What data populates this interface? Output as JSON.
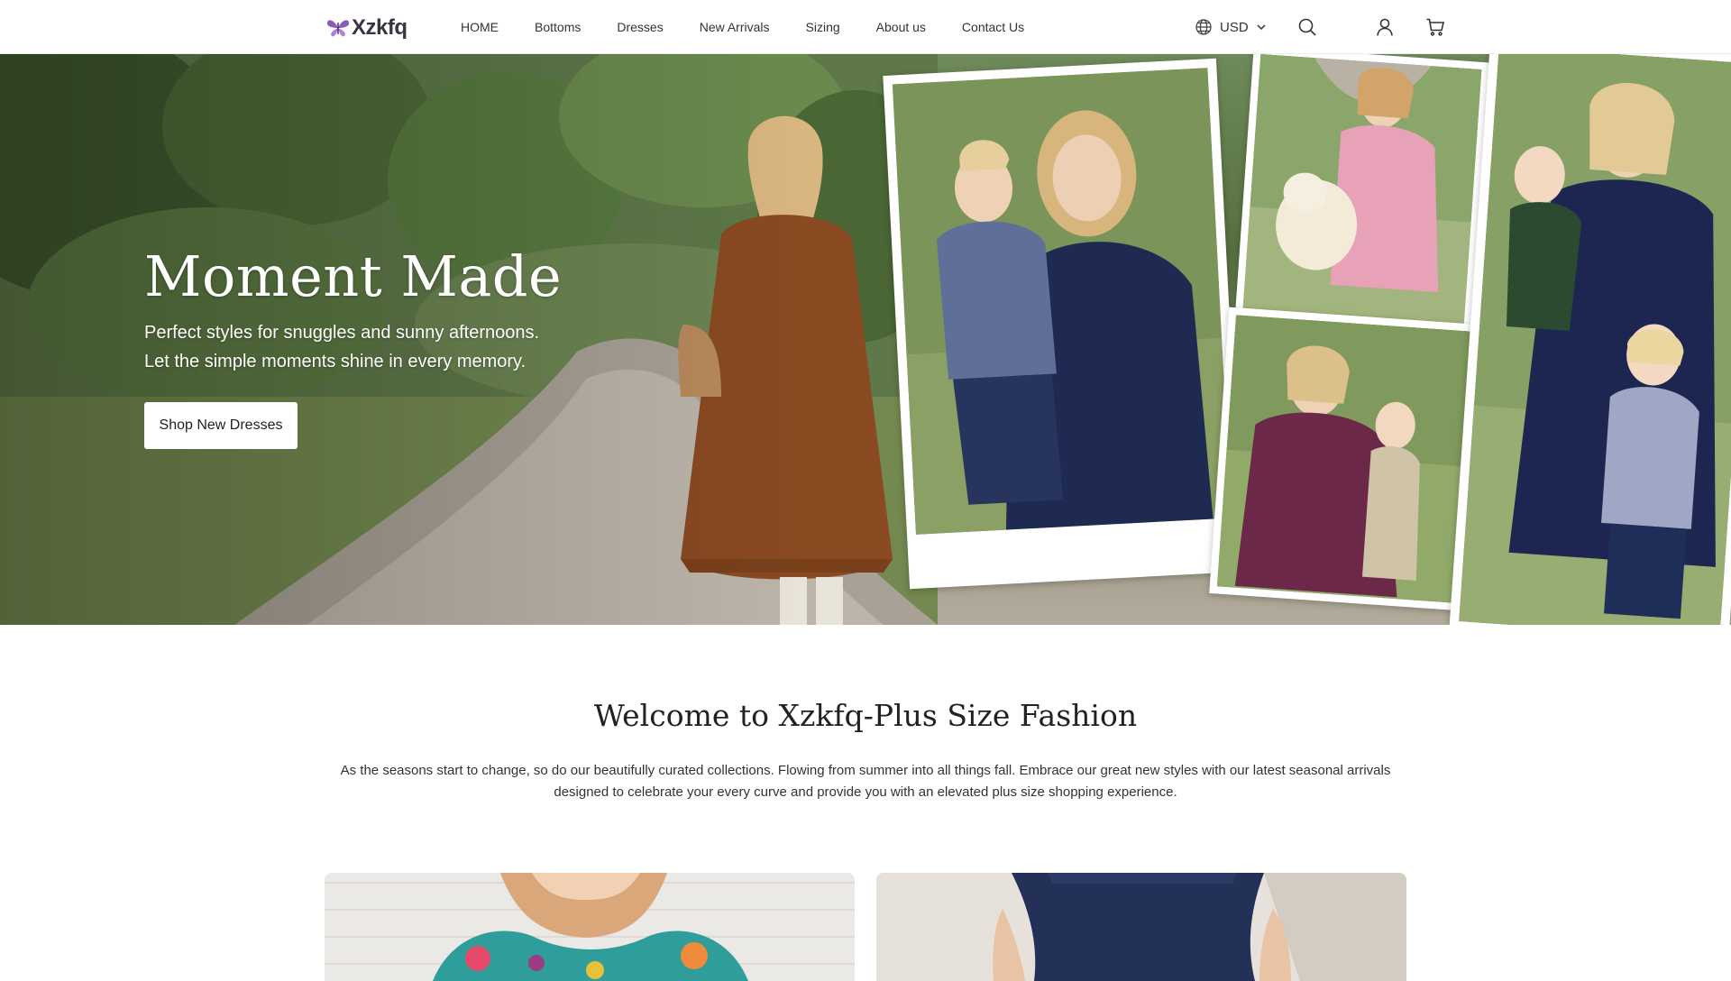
{
  "header": {
    "logo_text": "Xzkfq",
    "nav": [
      {
        "label": "HOME"
      },
      {
        "label": "Bottoms"
      },
      {
        "label": "Dresses"
      },
      {
        "label": "New Arrivals"
      },
      {
        "label": "Sizing"
      },
      {
        "label": "About us"
      },
      {
        "label": "Contact Us"
      }
    ],
    "currency": "USD",
    "icons": {
      "currency": "globe-icon",
      "currency_toggle": "chevron-down-icon",
      "search": "search-icon",
      "account": "user-icon",
      "cart": "cart-icon"
    }
  },
  "hero": {
    "title": "Moment Made",
    "subtitle_line1": "Perfect styles for snuggles and sunny afternoons.",
    "subtitle_line2": "Let the simple moments shine in every memory.",
    "button_label": "Shop New Dresses"
  },
  "welcome": {
    "title": "Welcome to Xzkfq-Plus Size Fashion",
    "text": "As the seasons start to change, so do our beautifully curated collections. Flowing from summer into all things fall. Embrace our great new styles with our latest seasonal arrivals designed to celebrate your every curve and provide you with an elevated plus size shopping experience."
  },
  "colors": {
    "logo_accent": "#7b4fa8",
    "text": "#222222",
    "hero_overlay_text": "#ffffff"
  }
}
